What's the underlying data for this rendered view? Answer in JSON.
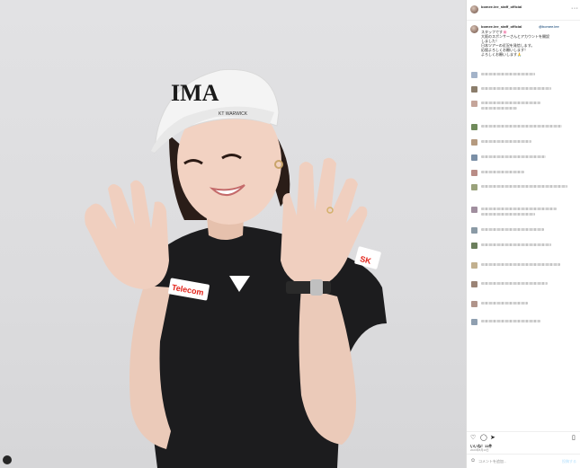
{
  "post": {
    "username": "bomee.lee_staff_official",
    "location": "",
    "menu_icon": "more-icon"
  },
  "caption": {
    "username": "bomee.lee_staff_official",
    "mention": "@bomee.lee",
    "lines": [
      "スタッフです🌸",
      "大阪のスポンサーさんとアカウントを開設",
      "しました！",
      "日本ツアーの近況を発信します。",
      "応援よろしくお願いします！",
      "よろしくお願いします🙏"
    ]
  },
  "photo_logos": {
    "cap_logo": "IMA",
    "cap_small": "KT WARWICK",
    "sleeve_text": "SK",
    "chest_text": "Telecom"
  },
  "footer": {
    "likes": "いいね！11件",
    "date": "2023年8月10日",
    "comment_placeholder": "コメントを追加...",
    "post_button": "投稿する"
  },
  "icons": {
    "heart": "heart-icon",
    "comment": "comment-icon",
    "share": "share-icon",
    "bookmark": "bookmark-icon",
    "emoji": "emoji-icon"
  },
  "colors": {
    "background_gray": "#dcdcde",
    "link_blue": "#00376b",
    "border": "#dbdbdb"
  }
}
